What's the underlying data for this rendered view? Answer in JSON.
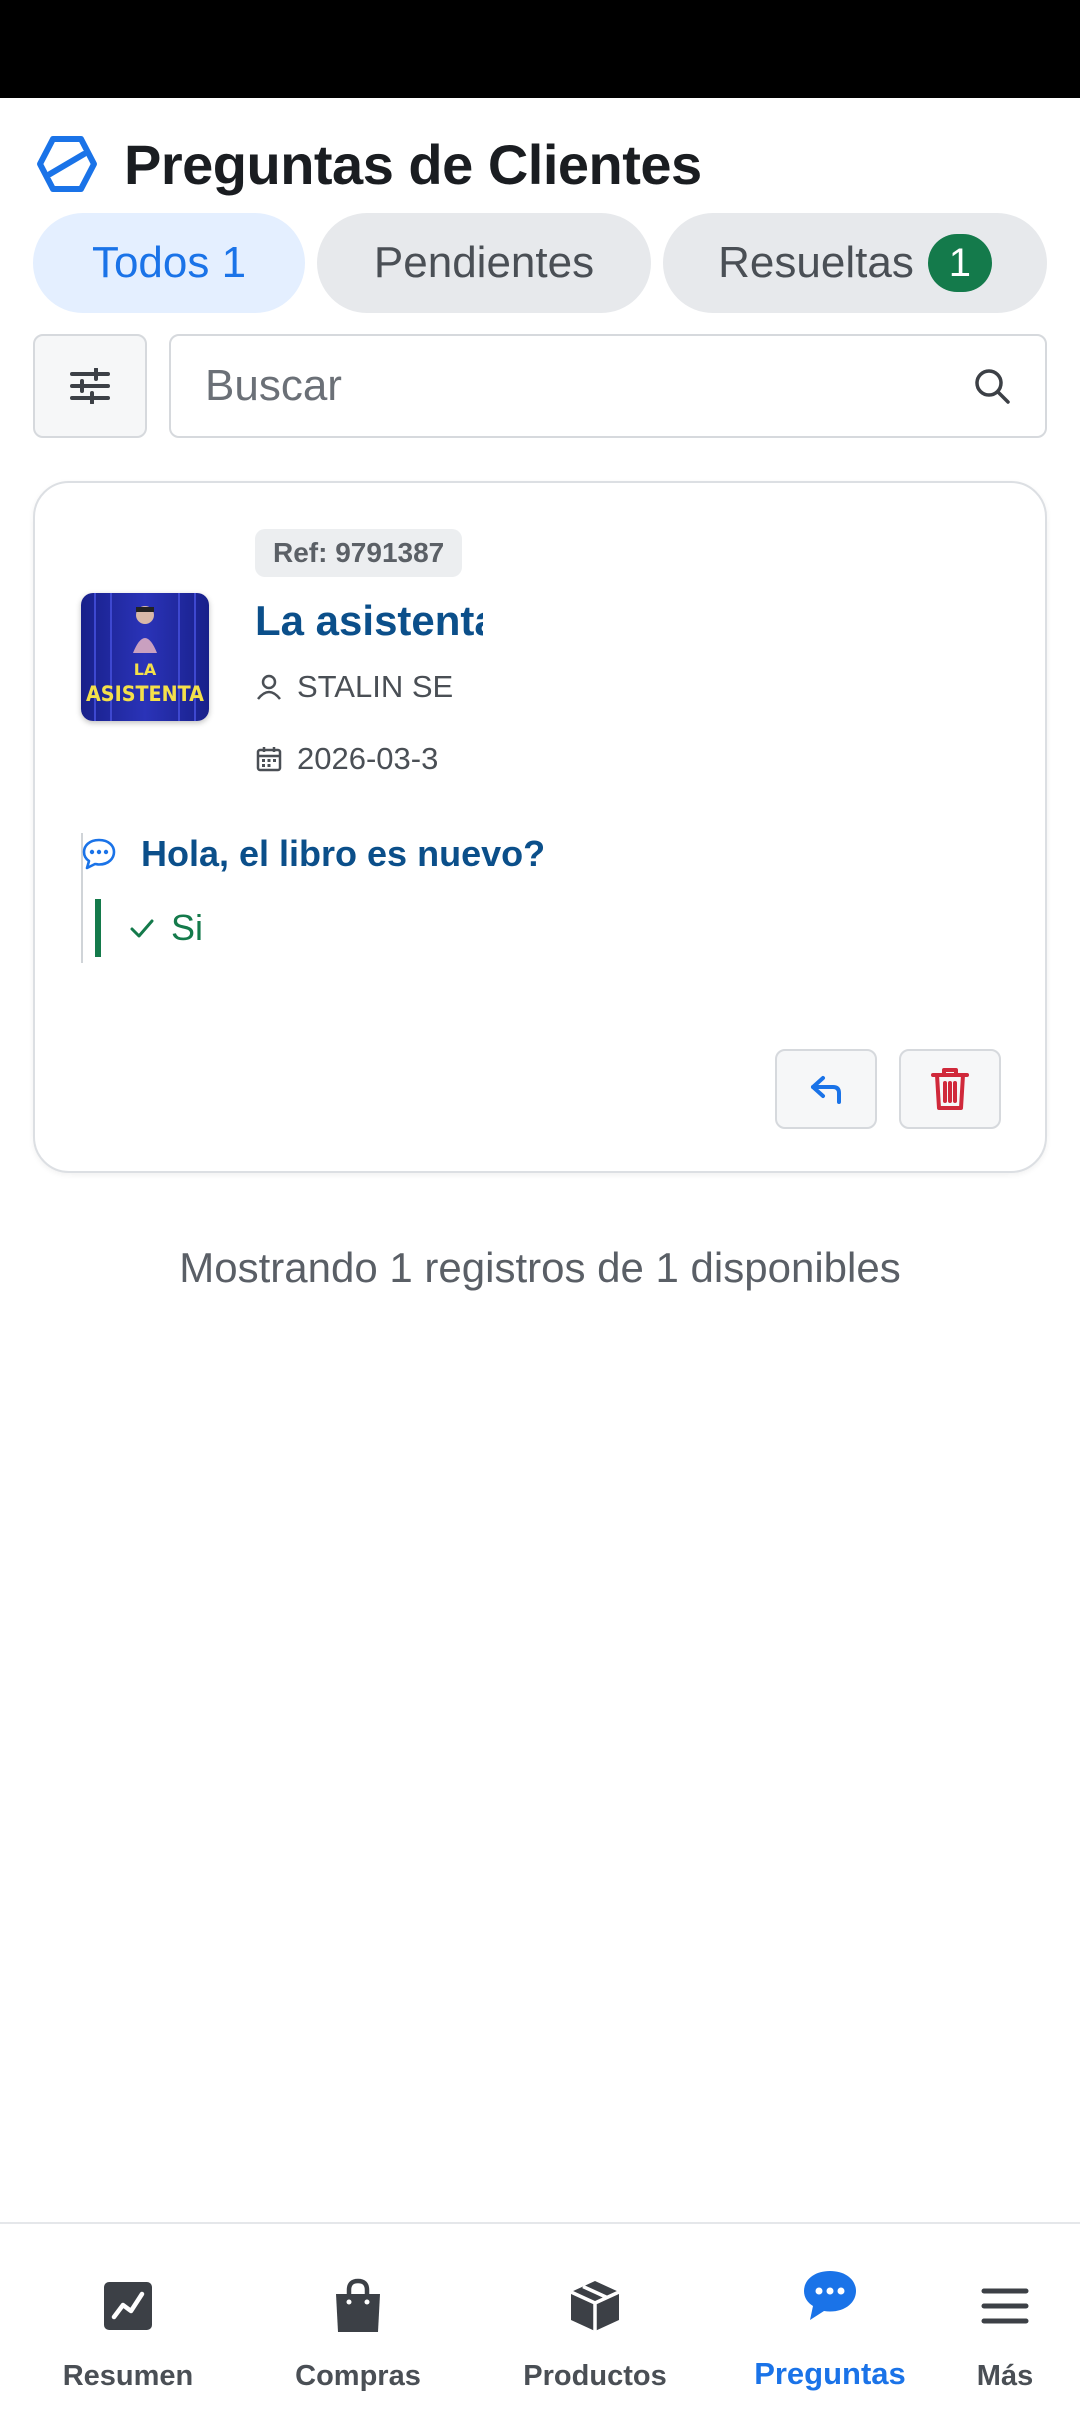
{
  "header": {
    "title": "Preguntas de Clientes"
  },
  "tabs": [
    {
      "label": "Todos 1",
      "active": true
    },
    {
      "label": "Pendientes",
      "active": false
    },
    {
      "label": "Resueltas",
      "badge": "1",
      "active": false
    }
  ],
  "search": {
    "placeholder": "Buscar"
  },
  "card": {
    "ref": "Ref: 9791387",
    "product_title": "La asistenta",
    "thumb_text_top": "LA",
    "thumb_text_bottom": "ASISTENTA",
    "customer": "STALIN SE",
    "date": "2026-03-3",
    "question": "Hola, el libro es nuevo?",
    "answer": "Si"
  },
  "summary": "Mostrando 1 registros de 1 disponibles",
  "nav": [
    {
      "label": "Resumen",
      "icon": "chart-icon",
      "active": false
    },
    {
      "label": "Compras",
      "icon": "shopping-bag-icon",
      "active": false
    },
    {
      "label": "Productos",
      "icon": "package-icon",
      "active": false
    },
    {
      "label": "Preguntas",
      "icon": "chat-bubble-icon",
      "active": true
    },
    {
      "label": "Más",
      "icon": "menu-icon",
      "active": false
    }
  ],
  "colors": {
    "accent": "#1a73e8",
    "title_blue": "#0b4f8a",
    "success": "#147a4b",
    "danger": "#d0293b"
  }
}
